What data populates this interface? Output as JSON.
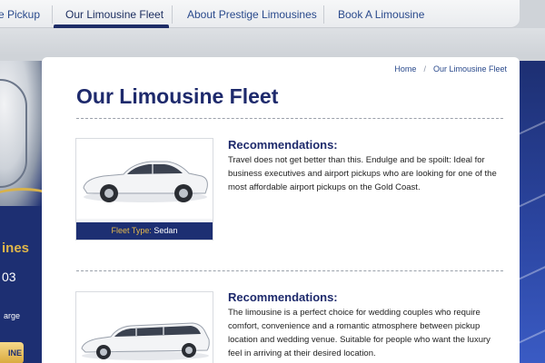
{
  "nav": {
    "items": [
      {
        "label": "e Pickup"
      },
      {
        "label": "Our Limousine Fleet"
      },
      {
        "label": "About Prestige Limousines"
      },
      {
        "label": "Book A Limousine"
      }
    ],
    "active_index": 1
  },
  "left_panel": {
    "title_partial": "ines",
    "phone_partial": "03",
    "text_partial": "arge",
    "button_partial": "INE"
  },
  "breadcrumb": {
    "home": "Home",
    "separator": "/",
    "current": "Our Limousine Fleet"
  },
  "page": {
    "title": "Our Limousine Fleet"
  },
  "fleet": [
    {
      "heading": "Recommendations:",
      "description": "Travel does not get better than this. Endulge and be spoilt: Ideal for business executives and airport pickups who are looking for one of the most affordable airport pickups on the Gold Coast.",
      "fleet_type_label": "Fleet Type:",
      "fleet_type_value": "Sedan",
      "image_icon": "sedan-car"
    },
    {
      "heading": "Recommendations:",
      "description": "The limousine is a perfect choice for wedding couples who require comfort, convenience and a romantic atmosphere between pickup location and wedding venue. Suitable for people who want the luxury feel in arriving at their desired location.",
      "image_icon": "stretch-limousine"
    }
  ],
  "colors": {
    "navy": "#1d2f72",
    "title": "#1e2a6c",
    "link": "#2a4a8c",
    "gold": "#e3b84b"
  }
}
